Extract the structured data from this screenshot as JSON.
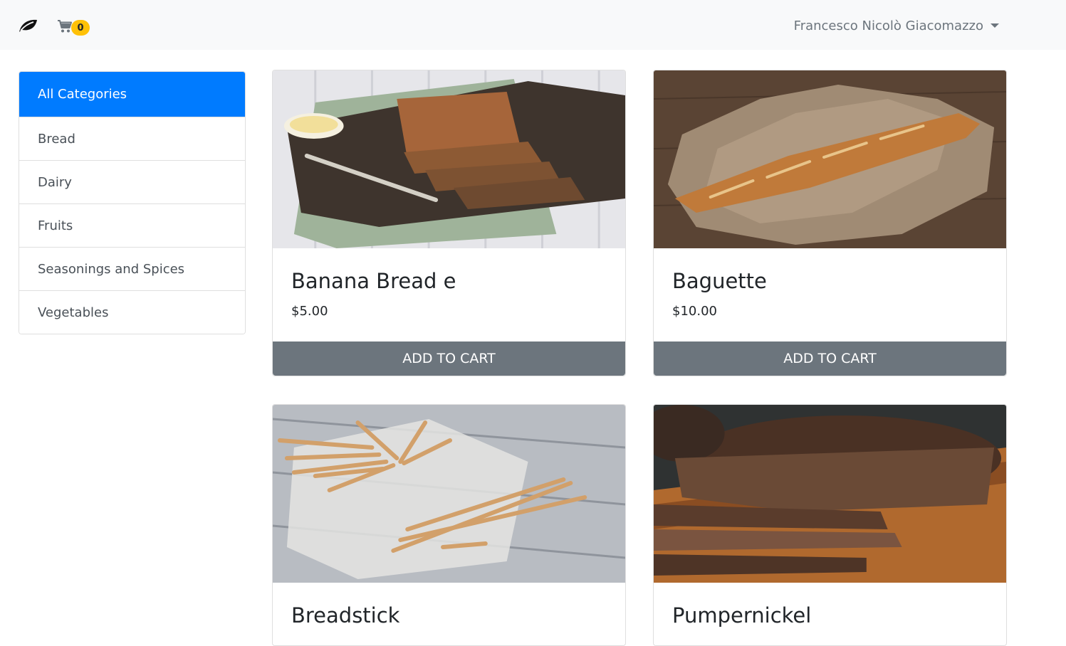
{
  "navbar": {
    "brand_icon": "leaf-icon",
    "cart_icon": "shopping-cart-icon",
    "cart_count": "0",
    "user_name": "Francesco Nicolò Giacomazzo",
    "user_dropdown_icon": "caret-down-icon"
  },
  "sidebar": {
    "items": [
      {
        "label": "All Categories",
        "active": true
      },
      {
        "label": "Bread"
      },
      {
        "label": "Dairy"
      },
      {
        "label": "Fruits"
      },
      {
        "label": "Seasonings and Spices"
      },
      {
        "label": "Vegetables"
      }
    ]
  },
  "products": [
    {
      "name": "Banana Bread e",
      "price": "$5.00",
      "button": "ADD TO CART"
    },
    {
      "name": "Baguette",
      "price": "$10.00",
      "button": "ADD TO CART"
    },
    {
      "name": "Breadstick"
    },
    {
      "name": "Pumpernickel"
    }
  ],
  "colors": {
    "primary": "#007bff",
    "secondary": "#6c757d",
    "warning": "#ffc107",
    "navbar_bg": "#f8f9fa"
  }
}
